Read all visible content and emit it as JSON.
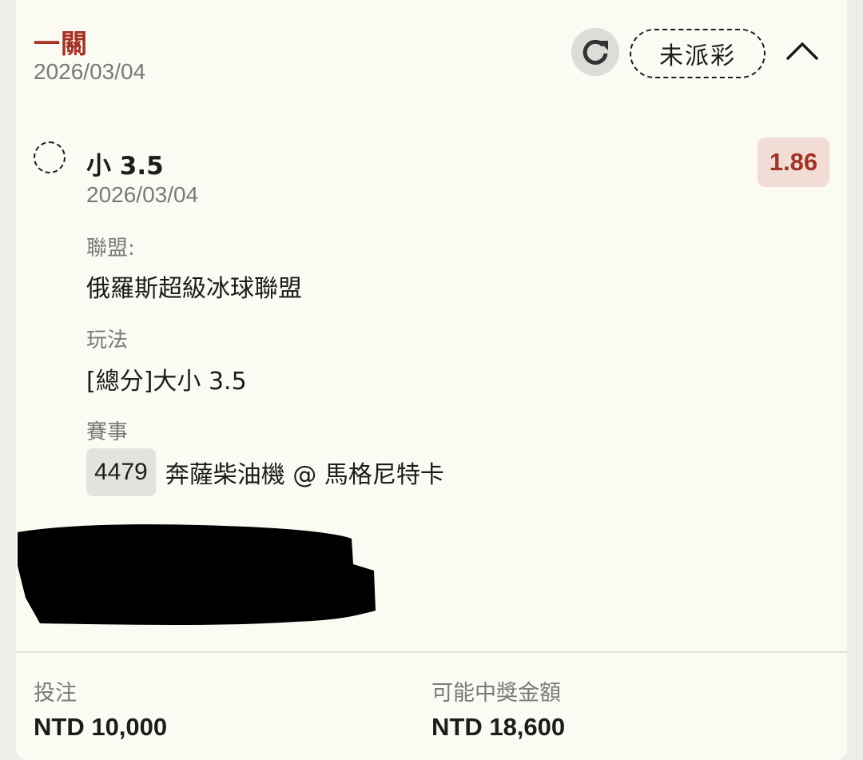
{
  "header": {
    "bet_type": "一關",
    "date": "2026/03/04",
    "status": "未派彩"
  },
  "selection": {
    "name": "小 3.5",
    "date": "2026/03/04",
    "odds": "1.86"
  },
  "details": {
    "league_label": "聯盟:",
    "league_value": "俄羅斯超級冰球聯盟",
    "market_label": "玩法",
    "market_value": "[總分]大小 3.5",
    "event_label": "賽事",
    "event_id": "4479",
    "event_name": "奔薩柴油機 @ 馬格尼特卡"
  },
  "summary": {
    "stake_label": "投注",
    "stake_value": "NTD 10,000",
    "payout_label": "可能中獎金額",
    "payout_value": "NTD 18,600"
  },
  "colors": {
    "accent": "#a23324",
    "odds_bg": "#f1dcd6",
    "card_bg": "#fbfaf3",
    "muted_text": "#7a7a7a"
  },
  "icons": {
    "refresh": "refresh-icon",
    "collapse": "chevron-up-icon",
    "selection": "dashed-circle-icon"
  }
}
